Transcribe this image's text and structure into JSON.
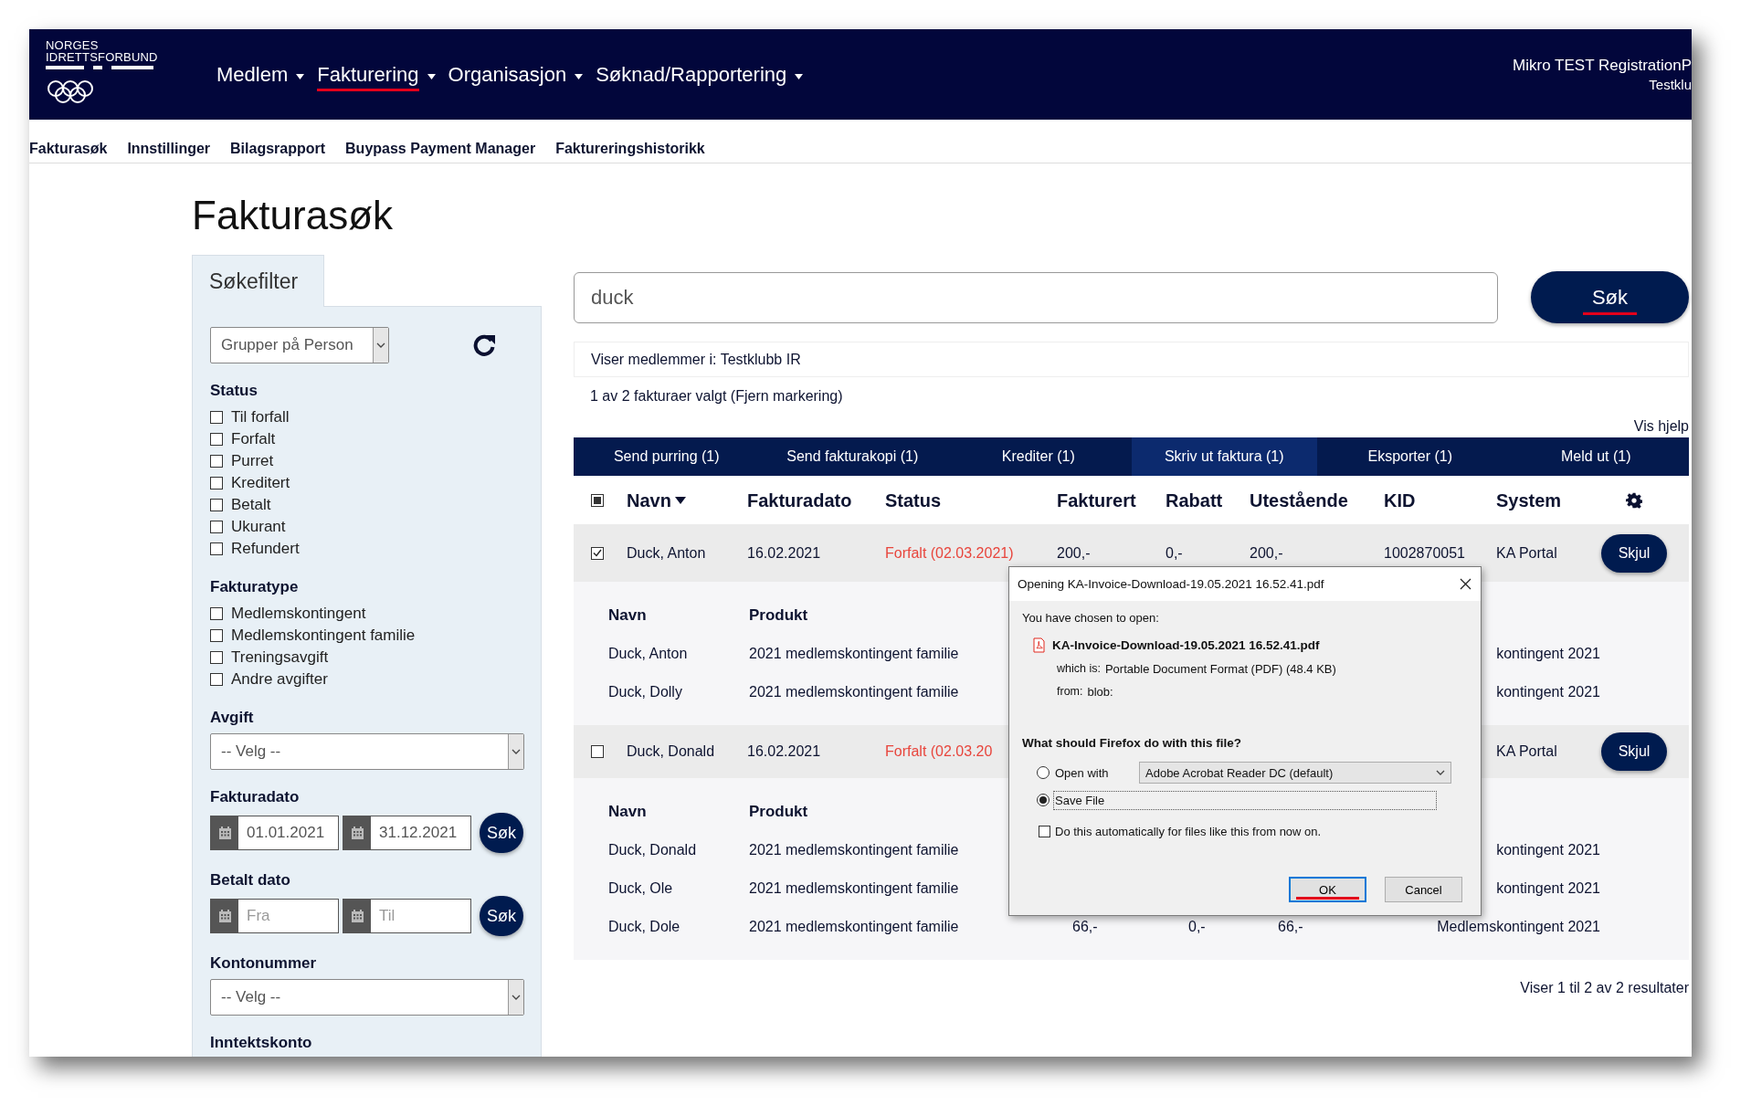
{
  "header": {
    "logo_lines": [
      "NORGES",
      "IDRETTSFORBUND"
    ],
    "nav": [
      {
        "label": "Medlem",
        "selected": false
      },
      {
        "label": "Fakturering",
        "selected": true
      },
      {
        "label": "Organisasjon",
        "selected": false
      },
      {
        "label": "Søknad/Rapportering",
        "selected": false
      }
    ],
    "user": {
      "name": "Mikro TEST RegistrationP",
      "club": "Testklu"
    }
  },
  "subnav": [
    {
      "label": "Fakturasøk"
    },
    {
      "label": "Innstillinger"
    },
    {
      "label": "Bilagsrapport"
    },
    {
      "label": "Buypass Payment Manager"
    },
    {
      "label": "Faktureringshistorikk"
    }
  ],
  "page_title": "Fakturasøk",
  "filter": {
    "tab": "Søkefilter",
    "group_select": "Grupper på Person",
    "sections": [
      {
        "kind": "checklist",
        "title": "Status",
        "items": [
          {
            "label": "Til forfall",
            "checked": false
          },
          {
            "label": "Forfalt",
            "checked": false
          },
          {
            "label": "Purret",
            "checked": false
          },
          {
            "label": "Kreditert",
            "checked": false
          },
          {
            "label": "Betalt",
            "checked": false
          },
          {
            "label": "Ukurant",
            "checked": false
          },
          {
            "label": "Refundert",
            "checked": false
          }
        ]
      },
      {
        "kind": "checklist",
        "title": "Fakturatype",
        "items": [
          {
            "label": "Medlemskontingent",
            "checked": false
          },
          {
            "label": "Medlemskontingent familie",
            "checked": false
          },
          {
            "label": "Treningsavgift",
            "checked": false
          },
          {
            "label": "Andre avgifter",
            "checked": false
          }
        ]
      },
      {
        "kind": "select",
        "title": "Avgift",
        "value": "-- Velg --"
      },
      {
        "kind": "daterange",
        "title": "Fakturadato",
        "from": {
          "value": "01.01.2021"
        },
        "to": {
          "value": "31.12.2021"
        },
        "button": "Søk"
      },
      {
        "kind": "daterange",
        "title": "Betalt dato",
        "from": {
          "placeholder": "Fra"
        },
        "to": {
          "placeholder": "Til"
        },
        "button": "Søk"
      },
      {
        "kind": "select",
        "title": "Kontonummer",
        "value": "-- Velg --"
      },
      {
        "kind": "heading",
        "title": "Inntektskonto"
      }
    ]
  },
  "search": {
    "value": "duck",
    "button": {
      "label": "Søk",
      "marked": true
    }
  },
  "scope": "Viser medlemmer i: Testklubb IR",
  "selection": {
    "text": "1 av 2 fakturaer valgt",
    "link": "(Fjern markering)"
  },
  "help_link": "Vis hjelp",
  "actions": [
    {
      "label": "Send purring (1)",
      "selected": false
    },
    {
      "label": "Send fakturakopi (1)",
      "selected": false
    },
    {
      "label": "Krediter (1)",
      "selected": false
    },
    {
      "label": "Skriv ut faktura (1)",
      "selected": true
    },
    {
      "label": "Eksporter (1)",
      "selected": false
    },
    {
      "label": "Meld ut (1)",
      "selected": false
    }
  ],
  "table": {
    "select_all": {
      "checked": false,
      "indeterminate": true
    },
    "columns": [
      {
        "label": "Navn",
        "sorted": true
      },
      {
        "label": "Fakturadato",
        "sorted": false
      },
      {
        "label": "Status",
        "sorted": false
      },
      {
        "label": "Fakturert",
        "sorted": false
      },
      {
        "label": "Rabatt",
        "sorted": false
      },
      {
        "label": "Utestående",
        "sorted": false
      },
      {
        "label": "KID",
        "sorted": false
      },
      {
        "label": "System",
        "sorted": false
      }
    ],
    "rows": [
      {
        "checked": true,
        "overdue": true,
        "cells": {
          "navn": "Duck, Anton",
          "fakturadato": "16.02.2021",
          "status": "Forfalt (02.03.2021)",
          "fakturert": "200,-",
          "rabatt": "0,-",
          "utestaende": "200,-",
          "kid": "1002870051",
          "system": "KA Portal"
        },
        "button": "Skjul",
        "details": {
          "columns": [
            "Navn",
            "Produkt"
          ],
          "rows": [
            {
              "navn": "Duck, Anton",
              "produkt": "2021 medlemskontingent familie",
              "column_6": "kontingent 2021"
            },
            {
              "navn": "Duck, Dolly",
              "produkt": "2021 medlemskontingent familie",
              "column_6": "kontingent 2021"
            }
          ]
        }
      },
      {
        "checked": false,
        "overdue": true,
        "cells": {
          "navn": "Duck, Donald",
          "fakturadato": "16.02.2021",
          "status": "Forfalt (02.03.20",
          "system": "KA Portal"
        },
        "button": "Skjul",
        "details": {
          "columns": [
            "Navn",
            "Produkt"
          ],
          "rows": [
            {
              "navn": "Duck, Donald",
              "produkt": "2021 medlemskontingent familie",
              "column_6": "kontingent 2021"
            },
            {
              "navn": "Duck, Ole",
              "produkt": "2021 medlemskontingent familie",
              "column_6": "kontingent 2021"
            },
            {
              "navn": "Duck, Dole",
              "produkt": "2021 medlemskontingent familie",
              "column_3": "66,-",
              "column_4": "0,-",
              "column_5": "66,-",
              "column_6": "Medlemskontingent 2021"
            }
          ]
        }
      }
    ]
  },
  "footer": "Viser 1 til 2 av 2 resultater",
  "dialog": {
    "title": "Opening KA-Invoice-Download-19.05.2021 16.52.41.pdf",
    "intro": "You have chosen to open:",
    "file_name": "KA-Invoice-Download-19.05.2021 16.52.41.pdf",
    "details": [
      {
        "label": "which is:",
        "value": "Portable Document Format (PDF) (48.4 KB)"
      },
      {
        "label": "from:",
        "value": "blob:"
      }
    ],
    "question": "What should Firefox do with this file?",
    "options": [
      {
        "label": "Open with",
        "selected": false,
        "app": "Adobe Acrobat Reader DC (default)"
      },
      {
        "label": "Save File",
        "selected": true
      }
    ],
    "auto": {
      "label": "Do this automatically for files like this from now on.",
      "checked": false
    },
    "buttons": [
      {
        "label": "OK",
        "default": true,
        "marked": true
      },
      {
        "label": "Cancel",
        "default": false,
        "marked": false
      }
    ]
  }
}
